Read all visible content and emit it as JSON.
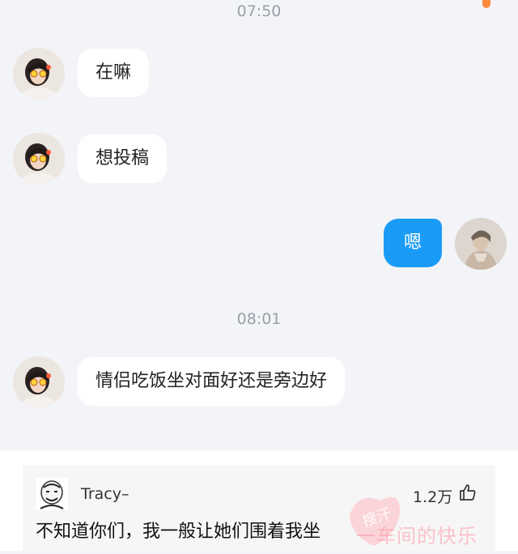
{
  "conversation": {
    "timestamps": [
      "07:50",
      "08:01"
    ],
    "messages": [
      {
        "sender": "other",
        "text": "在嘛"
      },
      {
        "sender": "other",
        "text": "想投稿"
      },
      {
        "sender": "self",
        "text": "嗯"
      },
      {
        "sender": "other",
        "text": "情侣吃饭坐对面好还是旁边好"
      }
    ]
  },
  "comment": {
    "username": "Tracy–",
    "likes": "1.2万",
    "text": "不知道你们，我一般让她们围着我坐"
  },
  "watermark": {
    "seal_text": "搜汗",
    "text": "一车间的快乐"
  },
  "colors": {
    "background": "#f3f4f8",
    "bubble_other": "#ffffff",
    "bubble_self": "#1a9cf6",
    "timestamp": "#9aa0a8"
  }
}
